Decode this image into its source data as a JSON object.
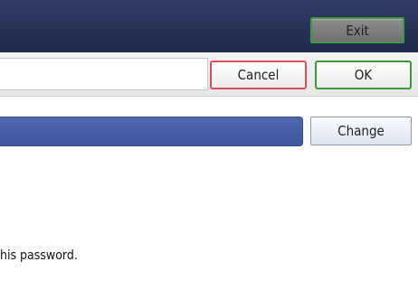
{
  "header": {
    "exit_label": "Exit"
  },
  "toolbar": {
    "cancel_label": "Cancel",
    "ok_label": "OK"
  },
  "field": {
    "change_label": "Change"
  },
  "body": {
    "message": "his password."
  },
  "colors": {
    "header_navy": "#26345a",
    "field_blue": "#4660a7",
    "ok_border": "#3a9a3a",
    "cancel_border": "#d9505b"
  }
}
